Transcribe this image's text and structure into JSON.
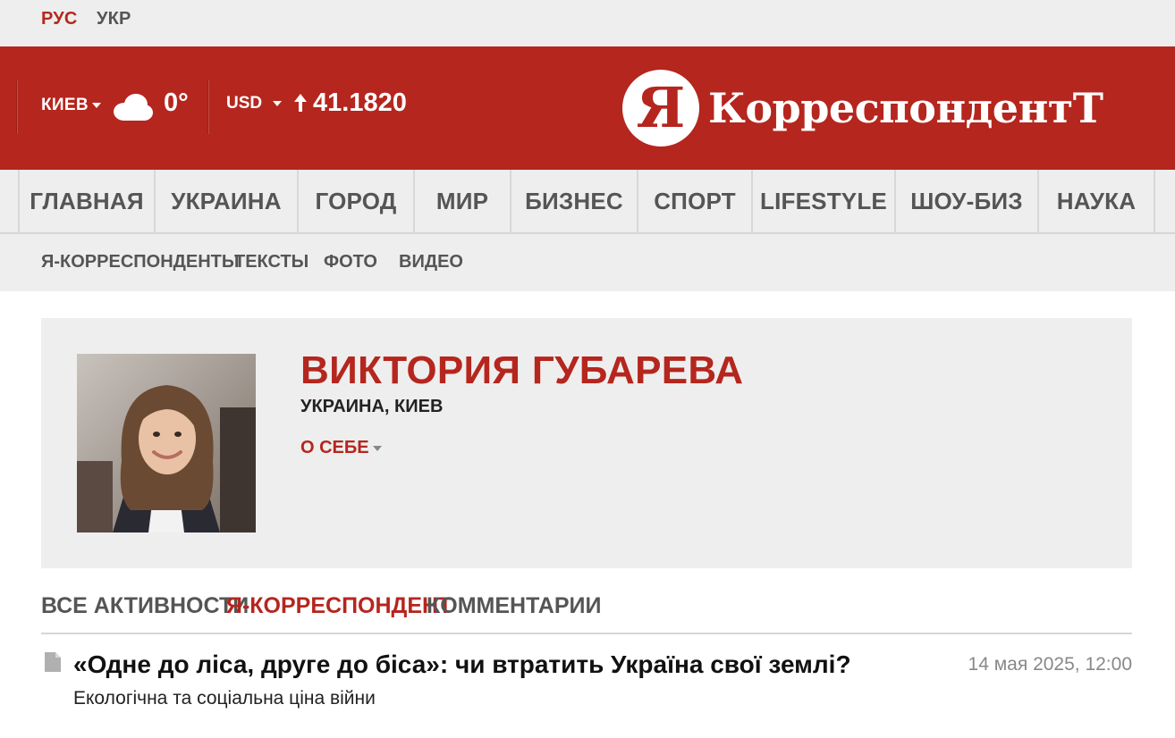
{
  "lang": {
    "ru": "РУС",
    "ua": "УКР"
  },
  "header": {
    "city": "КИЕВ",
    "temperature": "0°",
    "currency": "USD",
    "rate": "41.1820",
    "logo_letter": "Я",
    "logo_word": "КорреспондентТ"
  },
  "nav": [
    {
      "label": "ГЛАВНАЯ"
    },
    {
      "label": "УКРАИНА"
    },
    {
      "label": "ГОРОД"
    },
    {
      "label": "МИР"
    },
    {
      "label": "БИЗНЕС"
    },
    {
      "label": "СПОРТ"
    },
    {
      "label": "LIFESTYLE"
    },
    {
      "label": "ШОУ-БИЗ"
    },
    {
      "label": "НАУКА"
    }
  ],
  "subnav": [
    {
      "label": "Я-КОРРЕСПОНДЕНТЫ"
    },
    {
      "label": "ТЕКСТЫ"
    },
    {
      "label": "ФОТО"
    },
    {
      "label": "ВИДЕО"
    }
  ],
  "profile": {
    "name": "ВИКТОРИЯ ГУБАРЕВА",
    "location": "УКРАИНА, КИЕВ",
    "about": "О СЕБЕ"
  },
  "tabs": [
    {
      "label": "ВСЕ АКТИВНОСТИ",
      "active": false
    },
    {
      "label": "Я-КОРРЕСПОНДЕНТ",
      "active": true
    },
    {
      "label": "КОММЕНТАРИИ",
      "active": false
    }
  ],
  "articles": [
    {
      "title": "«Одне до ліса, друге до біса»: чи втратить Україна свої землі?",
      "subtitle": "Екологічна та соціальна ціна війни",
      "date": "14 мая 2025, 12:00"
    }
  ],
  "colors": {
    "brand_red": "#b5261e",
    "nav_bg": "#eeeeee",
    "muted_text": "#555555"
  }
}
